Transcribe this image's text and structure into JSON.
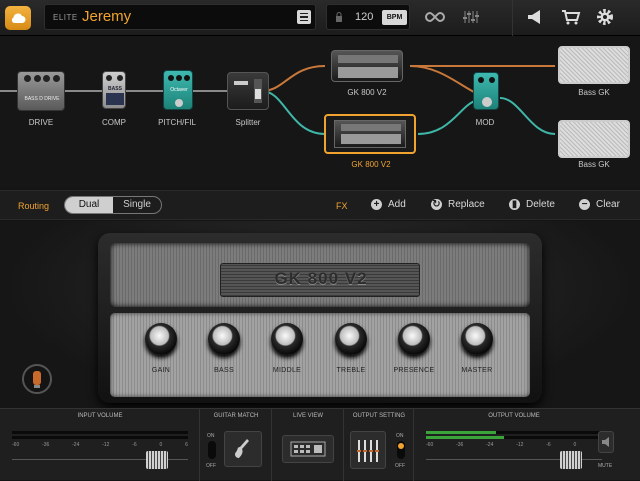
{
  "topbar": {
    "tier": "ELITE",
    "preset_name": "Jeremy",
    "bpm_value": "120",
    "bpm_button": "BPM",
    "icons": [
      "cloud-icon",
      "menu-icon",
      "lock-icon",
      "loop-icon",
      "mixer-icon",
      "announce-icon",
      "cart-icon",
      "gear-icon"
    ]
  },
  "chain": {
    "pedals": [
      {
        "label": "DRIVE",
        "face": "BASS D DRIVE"
      },
      {
        "label": "COMP",
        "face": "BASS"
      },
      {
        "label": "PITCH/FIL",
        "face": "Octaver"
      },
      {
        "label": "Splitter"
      },
      {
        "label": "GK 800 V2"
      },
      {
        "label": "GK 800 V2"
      },
      {
        "label": "MOD"
      },
      {
        "label": "Bass GK"
      },
      {
        "label": "Bass GK"
      }
    ],
    "colors": {
      "path_a": "#c8783a",
      "path_b": "#3fb7a8",
      "selected": "#f0a32f"
    }
  },
  "routing": {
    "label": "Routing",
    "dual": "Dual",
    "single": "Single",
    "fx": "FX",
    "add": "Add",
    "replace": "Replace",
    "delete": "Delete",
    "clear": "Clear"
  },
  "amp": {
    "name": "GK 800 V2",
    "knobs": [
      "GAIN",
      "BASS",
      "MIDDLE",
      "TREBLE",
      "PRESENCE",
      "MASTER"
    ]
  },
  "bottom": {
    "input_volume": "INPUT VOLUME",
    "guitar_match": "GUITAR MATCH",
    "live_view": "LIVE VIEW",
    "output_setting": "OUTPUT SETTING",
    "output_volume": "OUTPUT VOLUME",
    "on": "ON",
    "off": "OFF",
    "mute": "MUTE",
    "scale": [
      "-60",
      "-36",
      "-24",
      "-12",
      "-6",
      "0",
      "6"
    ]
  }
}
